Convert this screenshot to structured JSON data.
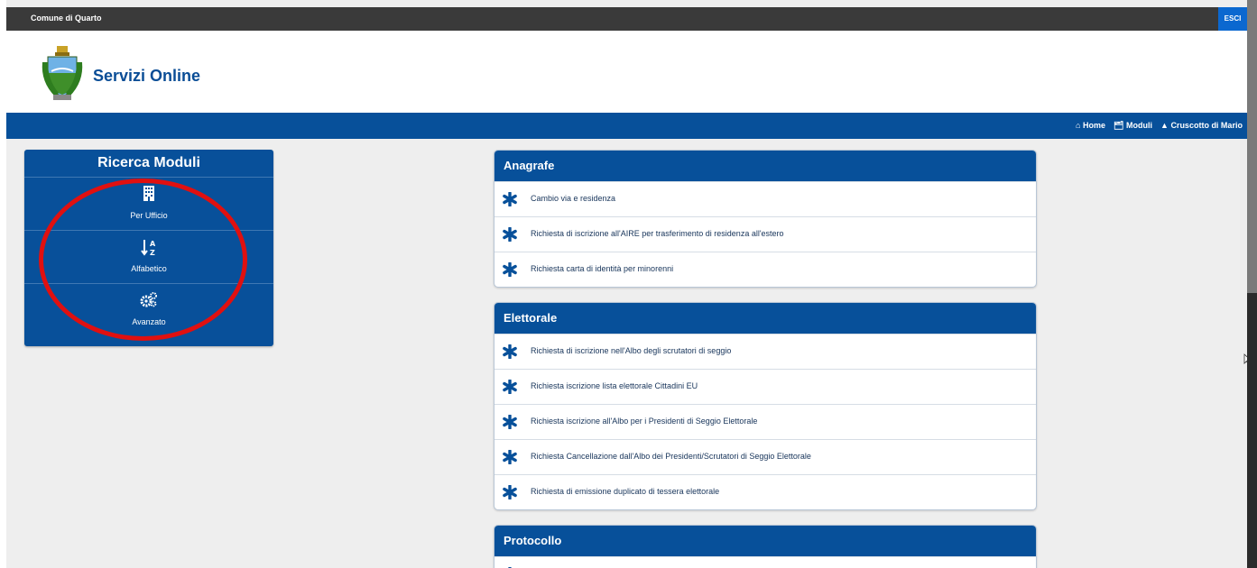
{
  "header": {
    "org_name": "Comune di Quarto",
    "logout_label": "ESCI",
    "site_title": "Servizi Online"
  },
  "nav": {
    "home": "Home",
    "moduli": "Moduli",
    "cruscotto": "Cruscotto di Mario",
    "icons": [
      "home-icon",
      "folder-open-icon",
      "car-icon"
    ]
  },
  "search_panel": {
    "title": "Ricerca Moduli",
    "options": [
      {
        "label": "Per Ufficio",
        "icon": "building-icon"
      },
      {
        "label": "Alfabetico",
        "icon": "sort-alpha-icon"
      },
      {
        "label": "Avanzato",
        "icon": "cogs-icon"
      }
    ]
  },
  "sections": [
    {
      "title": "Anagrafe",
      "items": [
        "Cambio via e residenza",
        "Richiesta di iscrizione all'AIRE per trasferimento di residenza all'estero",
        "Richiesta carta di identità per minorenni"
      ]
    },
    {
      "title": "Elettorale",
      "items": [
        "Richiesta di iscrizione nell'Albo degli scrutatori di seggio",
        "Richiesta iscrizione lista elettorale Cittadini EU",
        "Richiesta iscrizione all'Albo per i Presidenti di Seggio Elettorale",
        "Richiesta Cancellazione dall'Albo dei Presidenti/Scrutatori di Seggio Elettorale",
        "Richiesta di emissione duplicato di tessera elettorale"
      ]
    },
    {
      "title": "Protocollo",
      "items": []
    }
  ],
  "colors": {
    "primary": "#07509a",
    "topbar": "#3a3a3a",
    "logout": "#0b68d0",
    "annotation_ring": "#e01010",
    "background": "#eeeeee"
  }
}
